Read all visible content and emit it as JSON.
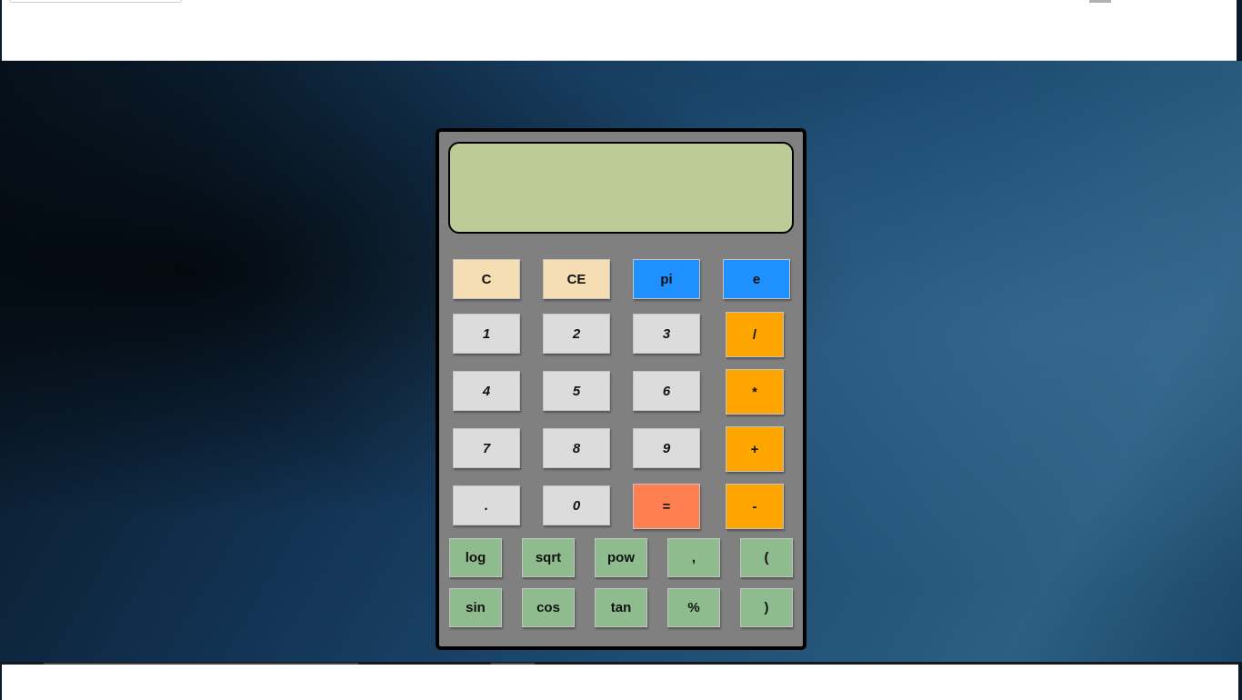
{
  "display": {
    "value": ""
  },
  "buttons": {
    "clear": "C",
    "clear_entry": "CE",
    "pi": "pi",
    "e": "e",
    "d1": "1",
    "d2": "2",
    "d3": "3",
    "d4": "4",
    "d5": "5",
    "d6": "6",
    "d7": "7",
    "d8": "8",
    "d9": "9",
    "decimal": ".",
    "d0": "0",
    "equals": "=",
    "divide": "/",
    "multiply": "*",
    "add": "+",
    "subtract": "-",
    "log": "log",
    "sqrt": "sqrt",
    "pow": "pow",
    "comma": ",",
    "open_paren": "(",
    "sin": "sin",
    "cos": "cos",
    "tan": "tan",
    "percent": "%",
    "close_paren": ")"
  },
  "colors": {
    "display_bg": "#bccc96",
    "body_bg": "#808080",
    "clear_keys": "#f5deb3",
    "constant_keys": "#1e90ff",
    "digit_keys": "#dcdcdc",
    "operator_keys": "#ffa500",
    "equals_key": "#ff7f50",
    "function_keys": "#8fbc8f"
  }
}
